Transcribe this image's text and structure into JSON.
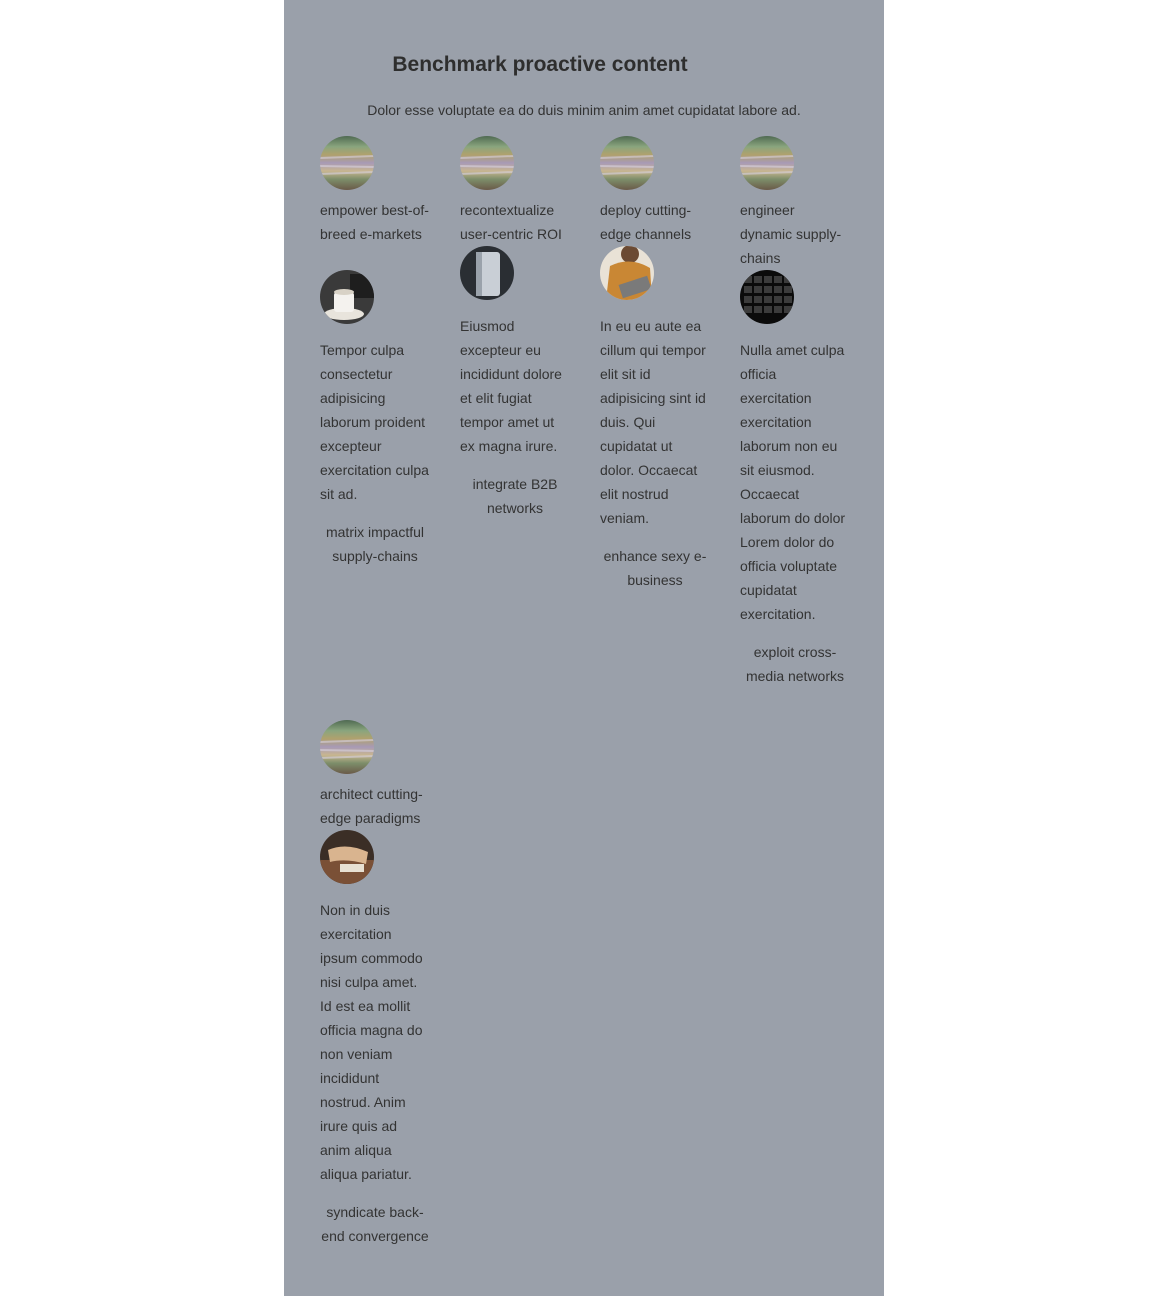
{
  "header": {
    "title": "Benchmark proactive content",
    "subtitle": "Dolor esse voluptate ea do duis minim anim amet cupidatat labore ad."
  },
  "features": [
    {
      "caption": "empower best-of-breed e-markets",
      "image": "landscape-texture-icon",
      "card_image": "coffee-cup-icon",
      "body": "Tempor culpa consectetur adipisicing laborum proident excepteur exercitation culpa sit ad.",
      "link": "matrix impactful supply-chains"
    },
    {
      "caption": "recontextualize user-centric ROI",
      "image": "landscape-texture-icon",
      "card_image": "device-photo-icon",
      "body": "Eiusmod excepteur eu incididunt dolore et elit fugiat tempor amet ut ex magna irure.",
      "link": "integrate B2B networks"
    },
    {
      "caption": "deploy cutting-edge channels",
      "image": "landscape-texture-icon",
      "card_image": "person-laptop-icon",
      "body": "In eu eu aute ea cillum qui tempor elit sit id adipisicing sint id duis. Qui cupidatat ut dolor. Occaecat elit nostrud veniam.",
      "link": "enhance sexy e-business"
    },
    {
      "caption": "engineer dynamic supply-chains",
      "image": "landscape-texture-icon",
      "card_image": "keyboard-icon",
      "body": "Nulla amet culpa officia exercitation exercitation laborum non eu sit eiusmod. Occaecat laborum do dolor Lorem dolor do officia voluptate cupidatat exercitation.",
      "link": "exploit cross-media networks"
    },
    {
      "caption": "architect cutting-edge paradigms",
      "image": "landscape-texture-icon",
      "card_image": "hands-book-icon",
      "body": "Non in duis exercitation ipsum commodo nisi culpa amet. Id est ea mollit officia magna do non veniam incididunt nostrud. Anim irure quis ad anim aliqua aliqua pariatur.",
      "link": "syndicate back-end convergence"
    }
  ]
}
